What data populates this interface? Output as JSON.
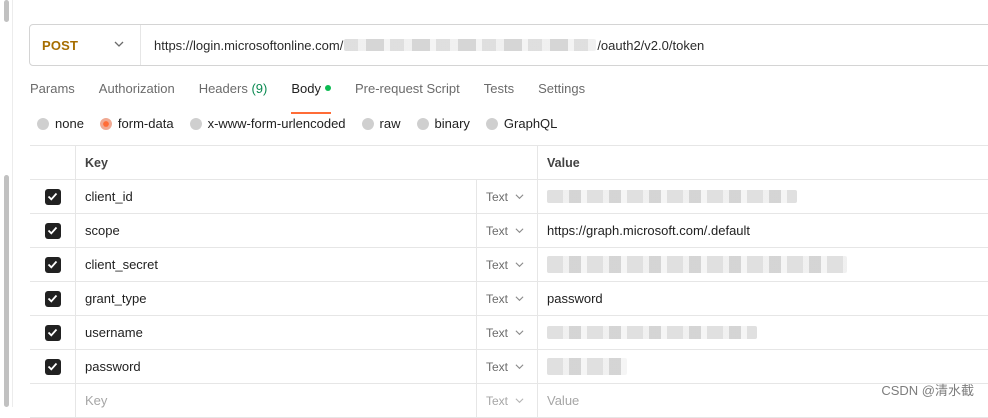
{
  "request": {
    "method": "POST",
    "url_prefix": "https://login.microsoftonline.com/",
    "url_suffix": "/oauth2/v2.0/token"
  },
  "tabs": [
    {
      "label": "Params"
    },
    {
      "label": "Authorization"
    },
    {
      "label": "Headers",
      "count": "(9)"
    },
    {
      "label": "Body",
      "active": true
    },
    {
      "label": "Pre-request Script"
    },
    {
      "label": "Tests"
    },
    {
      "label": "Settings"
    }
  ],
  "body_types": [
    "none",
    "form-data",
    "x-www-form-urlencoded",
    "raw",
    "binary",
    "GraphQL"
  ],
  "body_type_selected": "form-data",
  "table": {
    "headers": {
      "key": "Key",
      "value": "Value"
    },
    "rows": [
      {
        "checked": true,
        "key": "client_id",
        "type": "Text",
        "value": "",
        "value_redacted": true
      },
      {
        "checked": true,
        "key": "scope",
        "type": "Text",
        "value": "https://graph.microsoft.com/.default"
      },
      {
        "checked": true,
        "key": "client_secret",
        "type": "Text",
        "value": "",
        "value_redacted": true
      },
      {
        "checked": true,
        "key": "grant_type",
        "type": "Text",
        "value": "password"
      },
      {
        "checked": true,
        "key": "username",
        "type": "Text",
        "value": "",
        "value_redacted": true
      },
      {
        "checked": true,
        "key": "password",
        "type": "Text",
        "value": "",
        "value_redacted": true
      }
    ],
    "placeholder": {
      "key": "Key",
      "type": "Text",
      "value": "Value"
    }
  },
  "watermark": "CSDN @清水截",
  "colors": {
    "accent": "#ff6c37",
    "method": "#a66d00",
    "body_dot": "#0cbb52",
    "headers_count": "#0b8a52"
  }
}
